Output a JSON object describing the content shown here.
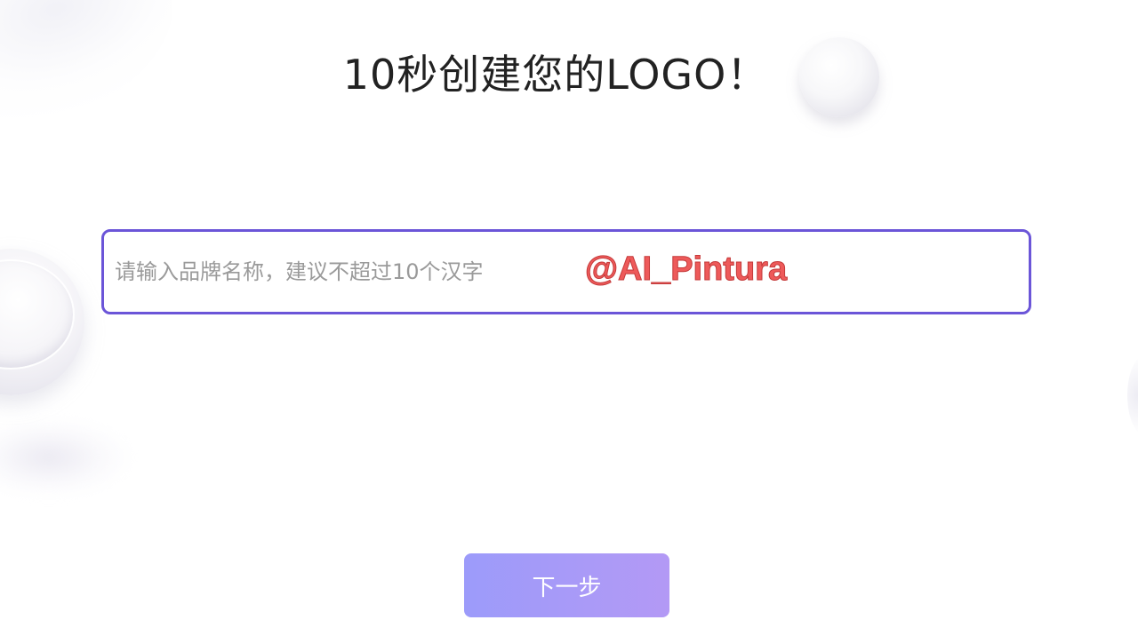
{
  "page": {
    "title": "10秒创建您的LOGO！"
  },
  "brand_input": {
    "placeholder": "请输入品牌名称，建议不超过10个汉字",
    "value": "",
    "border_color": "#6b55d8"
  },
  "watermark": {
    "text": "@AI_Pintura",
    "color": "#ee5a5a"
  },
  "actions": {
    "next_label": "下一步",
    "next_gradient": [
      "#9c9bfa",
      "#b399f5"
    ]
  },
  "decorations": {
    "icons": [
      "sphere-decoration",
      "disc-decoration"
    ]
  }
}
